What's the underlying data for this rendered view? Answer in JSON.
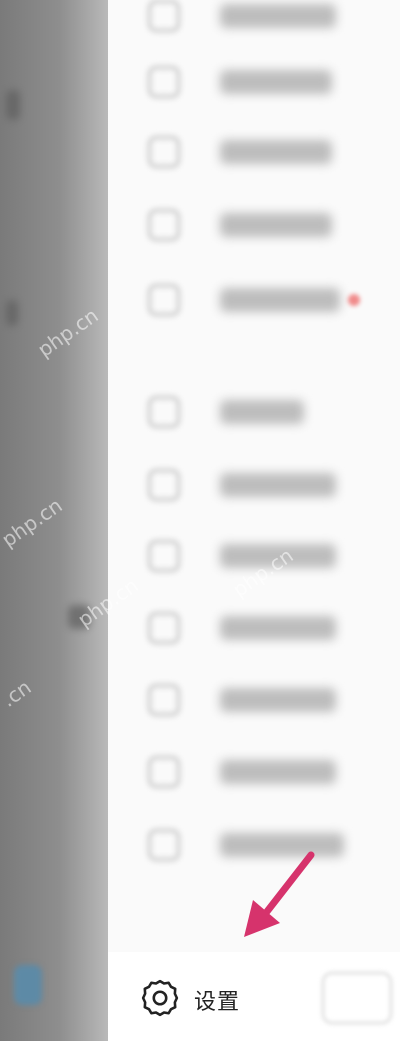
{
  "drawer": {
    "bottom": {
      "settings_label": "设置"
    }
  },
  "watermarks": [
    "php.cn",
    "php.cn",
    "php.cn",
    "php.cn",
    ".cn"
  ],
  "colors": {
    "arrow": "#d6336c",
    "backdrop": "#8a8a8a",
    "drawer": "#fafafa",
    "badge": "#f08a8a"
  }
}
